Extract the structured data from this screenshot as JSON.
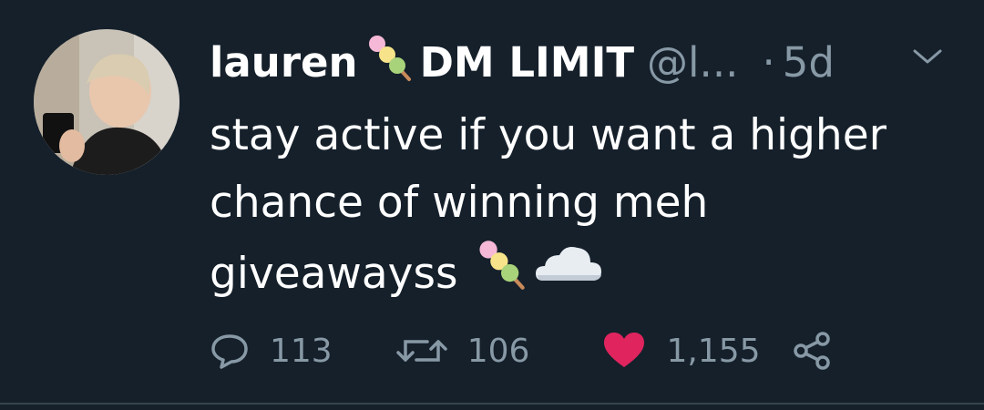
{
  "tweet": {
    "display_name": "lauren",
    "display_name_suffix": "DM LIMIT",
    "handle": "@l...",
    "separator": "·",
    "time": "5d",
    "text_line1": "stay active if you want a higher",
    "text_line2": "chance of winning meh",
    "text_line3": "giveawayss"
  },
  "actions": {
    "replies": "113",
    "retweets": "106",
    "likes": "1,155",
    "liked": true
  },
  "icons": {
    "name_emoji": "dango-emoji",
    "body_emoji_1": "dango-emoji",
    "body_emoji_2": "cloud-emoji",
    "reply": "reply-icon",
    "retweet": "retweet-icon",
    "like": "heart-icon",
    "share": "share-icon",
    "menu": "chevron-down-icon"
  },
  "colors": {
    "background": "#15202b",
    "text": "#ffffff",
    "secondary": "#8899a6",
    "like": "#e0245e"
  }
}
